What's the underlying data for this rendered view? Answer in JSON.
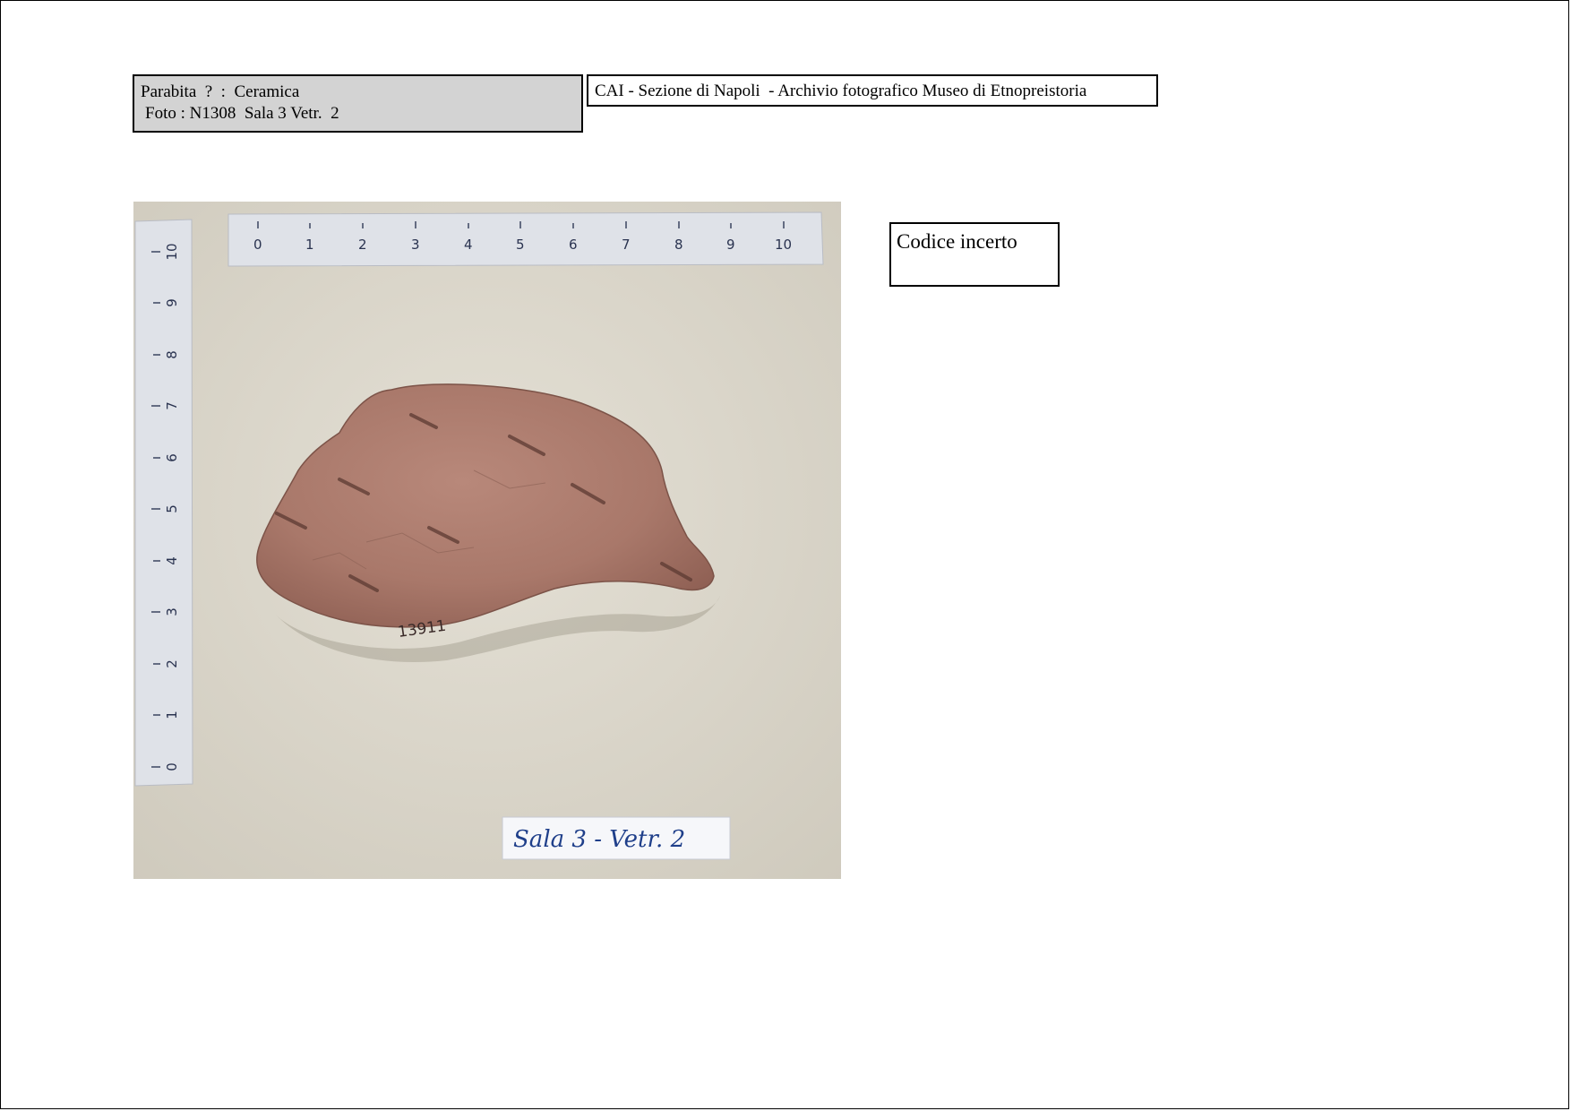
{
  "header": {
    "info_line1": "Parabita  ?  :  Ceramica",
    "info_line2": "Foto : N1308  Sala 3 Vetr.  2",
    "archive": "CAI - Sezione di Napoli  - Archivio fotografico Museo di Etnopreistoria"
  },
  "code_note": "Codice incerto",
  "photo": {
    "ruler_top_numbers": [
      "0",
      "1",
      "2",
      "3",
      "4",
      "5",
      "6",
      "7",
      "8",
      "9",
      "10"
    ],
    "ruler_left_numbers": [
      "0",
      "1",
      "2",
      "3",
      "4",
      "5",
      "6",
      "7",
      "8",
      "9",
      "10"
    ],
    "sherd_inventory_number": "13911",
    "label_card": "Sala 3 - Vetr. 2"
  }
}
